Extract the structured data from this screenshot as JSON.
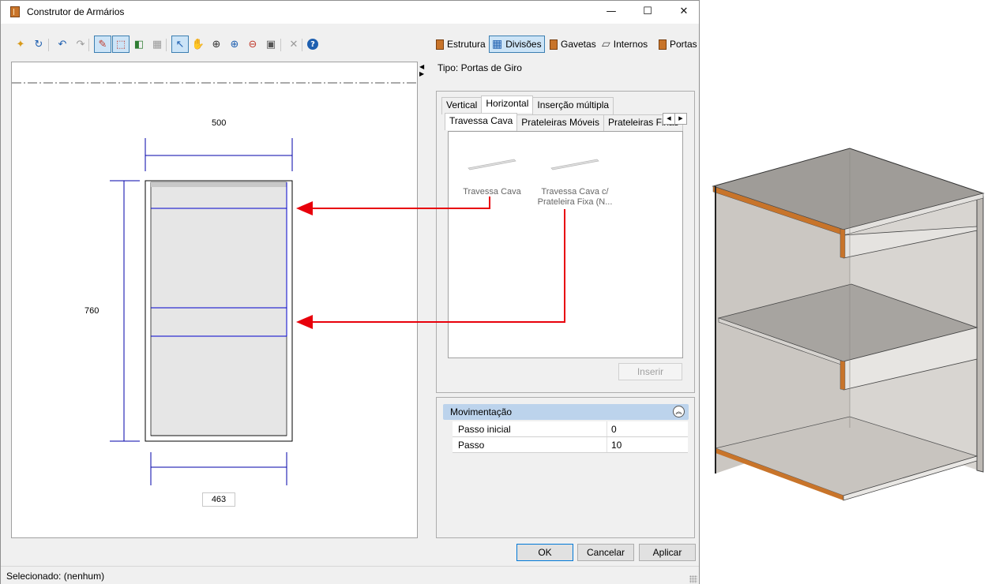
{
  "window": {
    "title": "Construtor de Armários",
    "controls": {
      "minimize": "—",
      "maximize": "☐",
      "close": "✕"
    }
  },
  "toolbar": {
    "tools": [
      {
        "name": "new-icon",
        "glyph": "✦",
        "color": "#d89a1a",
        "active": false
      },
      {
        "name": "reload-icon",
        "glyph": "↻",
        "color": "#1e5fb0",
        "active": false
      },
      {
        "name": "undo-icon",
        "glyph": "↶",
        "color": "#1e5fb0",
        "active": false
      },
      {
        "name": "redo-icon",
        "glyph": "↷",
        "color": "#9a9a9a",
        "active": false
      },
      {
        "name": "draw-line-icon",
        "glyph": "✎",
        "color": "#c0392b",
        "active": true
      },
      {
        "name": "draw-area-icon",
        "glyph": "⬚",
        "color": "#c0392b",
        "active": true
      },
      {
        "name": "flip-icon",
        "glyph": "◧",
        "color": "#2e7d32",
        "active": false
      },
      {
        "name": "grid-icon",
        "glyph": "▦",
        "color": "#9a9a9a",
        "active": false
      },
      {
        "name": "pointer-icon",
        "glyph": "↖",
        "color": "#1e5fb0",
        "active": true
      },
      {
        "name": "pan-icon",
        "glyph": "✋",
        "color": "#c8742a",
        "active": false
      },
      {
        "name": "zoom-window-icon",
        "glyph": "⊕",
        "color": "#333333",
        "active": false
      },
      {
        "name": "zoom-in-icon",
        "glyph": "⊕",
        "color": "#1e5fb0",
        "active": false
      },
      {
        "name": "zoom-out-icon",
        "glyph": "⊖",
        "color": "#c0392b",
        "active": false
      },
      {
        "name": "zoom-extents-icon",
        "glyph": "▣",
        "color": "#555555",
        "active": false
      },
      {
        "name": "delete-icon",
        "glyph": "✕",
        "color": "#9a9a9a",
        "active": false
      },
      {
        "name": "help-icon",
        "glyph": "?",
        "color": "#1e5fb0",
        "active": false
      }
    ],
    "sections": [
      {
        "label": "Estrutura",
        "icon": "door-icon",
        "active": false
      },
      {
        "label": "Divisões",
        "icon": "grid-icon",
        "active": true
      },
      {
        "label": "Gavetas",
        "icon": "drawer-icon",
        "active": false
      },
      {
        "label": "Internos",
        "icon": "shelves-icon",
        "active": false
      },
      {
        "label": "Portas",
        "icon": "door-icon",
        "active": false
      }
    ]
  },
  "drawing": {
    "width_top": "500",
    "height": "760",
    "width_bottom": "463"
  },
  "tipo": "Tipo: Portas de Giro",
  "tabs_primary": [
    "Vertical",
    "Horizontal",
    "Inserção múltipla"
  ],
  "tabs_secondary": [
    "Travessa Cava",
    "Prateleiras Móveis",
    "Prateleiras Fixas"
  ],
  "selected_primary": "Horizontal",
  "selected_secondary": "Travessa Cava",
  "items": [
    {
      "label": "Travessa Cava"
    },
    {
      "label": "Travessa Cava c/ Prateleira Fixa (N..."
    }
  ],
  "insert_button": "Inserir",
  "properties": {
    "group": "Movimentação",
    "rows": [
      {
        "name": "Passo inicial",
        "value": "0"
      },
      {
        "name": "Passo",
        "value": "10"
      }
    ]
  },
  "buttons": {
    "ok": "OK",
    "cancel": "Cancelar",
    "apply": "Aplicar"
  },
  "status": "Selecionado: (nenhum)",
  "colors": {
    "accent": "#0078d7",
    "arrow": "#e8000b",
    "dimension": "#0000aa",
    "wood": "#c8742a"
  }
}
